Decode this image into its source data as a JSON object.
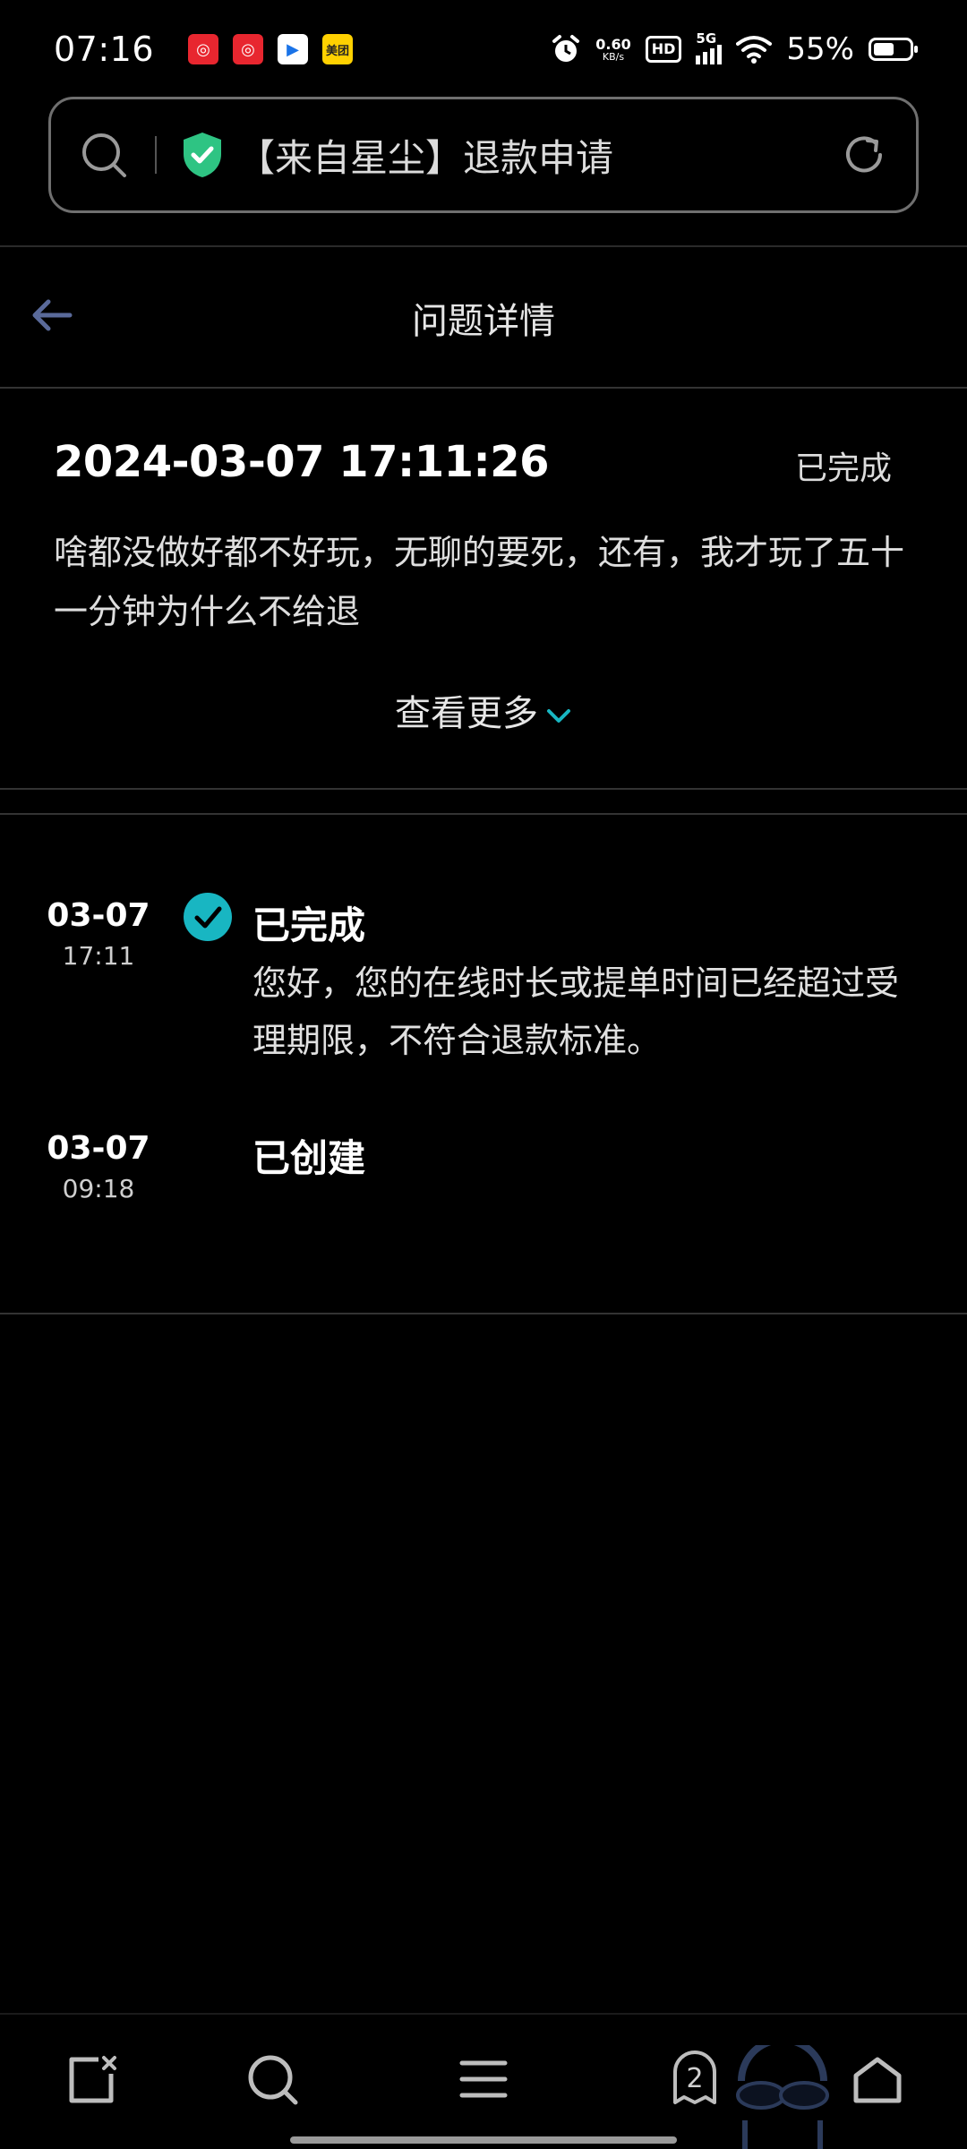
{
  "status_bar": {
    "time": "07:16",
    "app_badges": [
      "网易云",
      "网易云",
      "优酷",
      "美团"
    ],
    "net_speed_value": "0.60",
    "net_speed_unit": "KB/s",
    "hd_label": "HD",
    "network_label": "5G",
    "battery_percent": "55%",
    "battery_level": 0.55
  },
  "address_bar": {
    "title": "【来自星尘】退款申请",
    "shield_color": "#2ec483"
  },
  "header": {
    "title": "问题详情"
  },
  "issue": {
    "datetime": "2024-03-07 17:11:26",
    "status": "已完成",
    "description": "啥都没做好都不好玩，无聊的要死，还有，我才玩了五十一分钟为什么不给退",
    "see_more_label": "查看更多",
    "accent_color": "#18b6c2"
  },
  "timeline": [
    {
      "date": "03-07",
      "time": "17:11",
      "title": "已完成",
      "description": "您好，您的在线时长或提单时间已经超过受理期限，不符合退款标准。",
      "checked": true
    },
    {
      "date": "03-07",
      "time": "09:18",
      "title": "已创建",
      "description": "",
      "checked": false
    }
  ],
  "bottom_nav": {
    "icons": [
      "new-tab-icon",
      "search-icon",
      "menu-icon",
      "tabs-icon",
      "home-icon"
    ],
    "tab_count": "2"
  }
}
